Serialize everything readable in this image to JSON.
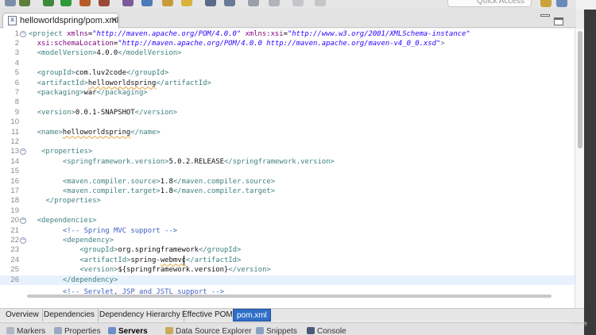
{
  "toolbar": {
    "quick_access_placeholder": "Quick Access"
  },
  "editor": {
    "tab_title": "helloworldspring/pom.xml",
    "lines": [
      {
        "n": "1",
        "html": "<span class=\"tag\">&lt;project</span> <span class=\"attr\">xmlns</span>=<span class=\"val\">\"http://maven.apache.org/POM/4.0.0\"</span> <span class=\"attr\">xmlns:xsi</span>=<span class=\"val\">\"http://www.w3.org/2001/XMLSchema-instance\"</span>",
        "indent": 0,
        "fold": true
      },
      {
        "n": "2",
        "html": "<span class=\"attr\">xsi:schemaLocation</span>=<span class=\"val\">\"http://maven.apache.org/POM/4.0.0 http://maven.apache.org/maven-v4_0_0.xsd\"</span><span class=\"tag\">&gt;</span>",
        "indent": 2
      },
      {
        "n": "3",
        "html": "<span class=\"tag\">&lt;modelVersion&gt;</span><span class=\"txt\">4.0.0</span><span class=\"tag\">&lt;/modelVersion&gt;</span>",
        "indent": 2
      },
      {
        "n": "4",
        "html": "",
        "indent": 0
      },
      {
        "n": "5",
        "html": "<span class=\"tag\">&lt;groupId&gt;</span><span class=\"txt\">com.luv2code</span><span class=\"tag\">&lt;/groupId&gt;</span>",
        "indent": 2
      },
      {
        "n": "6",
        "html": "<span class=\"tag\">&lt;artifactId&gt;</span><span class=\"txt sq\">helloworldspring</span><span class=\"tag\">&lt;/artifactId&gt;</span>",
        "indent": 2
      },
      {
        "n": "7",
        "html": "<span class=\"tag\">&lt;packaging&gt;</span><span class=\"txt\">war</span><span class=\"tag\">&lt;/packaging&gt;</span>",
        "indent": 2
      },
      {
        "n": "8",
        "html": "",
        "indent": 0
      },
      {
        "n": "9",
        "html": "<span class=\"tag\">&lt;version&gt;</span><span class=\"txt\">0.0.1-SNAPSHOT</span><span class=\"tag\">&lt;/version&gt;</span>",
        "indent": 2
      },
      {
        "n": "10",
        "html": "",
        "indent": 0
      },
      {
        "n": "11",
        "html": "<span class=\"tag\">&lt;name&gt;</span><span class=\"txt sq\">helloworldspring</span><span class=\"tag\">&lt;/name&gt;</span>",
        "indent": 2
      },
      {
        "n": "12",
        "html": "",
        "indent": 0
      },
      {
        "n": "13",
        "html": "<span class=\"tag\">&lt;properties&gt;</span>",
        "indent": 3,
        "fold": true
      },
      {
        "n": "14",
        "html": "<span class=\"tag\">&lt;springframework.version&gt;</span><span class=\"txt\">5.0.2.RELEASE</span><span class=\"tag\">&lt;/springframework.version&gt;</span>",
        "indent": 8
      },
      {
        "n": "15",
        "html": "",
        "indent": 0
      },
      {
        "n": "16",
        "html": "<span class=\"tag\">&lt;maven.compiler.source&gt;</span><span class=\"txt\">1.8</span><span class=\"tag\">&lt;/maven.compiler.source&gt;</span>",
        "indent": 8
      },
      {
        "n": "17",
        "html": "<span class=\"tag\">&lt;maven.compiler.target&gt;</span><span class=\"txt\">1.8</span><span class=\"tag\">&lt;/maven.compiler.target&gt;</span>",
        "indent": 8
      },
      {
        "n": "18",
        "html": "<span class=\"tag\">&lt;/properties&gt;</span>",
        "indent": 4
      },
      {
        "n": "19",
        "html": "",
        "indent": 0
      },
      {
        "n": "20",
        "html": "<span class=\"tag\">&lt;dependencies&gt;</span>",
        "indent": 2,
        "fold": true
      },
      {
        "n": "21",
        "html": "<span class=\"cmt\">&lt;!-- Spring MVC support --&gt;</span>",
        "indent": 8
      },
      {
        "n": "22",
        "html": "<span class=\"tag\">&lt;dependency&gt;</span>",
        "indent": 8,
        "fold": true
      },
      {
        "n": "23",
        "html": "<span class=\"tag\">&lt;groupId&gt;</span><span class=\"txt\">org.springframework</span><span class=\"tag\">&lt;/groupId&gt;</span>",
        "indent": 12
      },
      {
        "n": "24",
        "html": "<span class=\"tag\">&lt;artifactId&gt;</span><span class=\"txt\">spring-<span class=\"sq\">webmvc</span></span><span class=\"tag\">&lt;/artifactId&gt;</span>",
        "indent": 12
      },
      {
        "n": "25",
        "html": "<span class=\"tag\">&lt;version&gt;</span><span class=\"txt\">${springframework.version}</span><span class=\"tag\">&lt;/version&gt;</span>",
        "indent": 12
      },
      {
        "n": "26",
        "html": "<span class=\"tag\">&lt;/dependency&gt;</span>",
        "indent": 8,
        "current": true
      },
      {
        "n": "",
        "html": "<span class=\"cmt\">&lt;!-- Servlet, JSP and JSTL support --&gt;</span>",
        "indent": 8,
        "cut": true
      }
    ]
  },
  "page_tabs": [
    {
      "label": "Overview"
    },
    {
      "label": "Dependencies"
    },
    {
      "label": "Dependency Hierarchy"
    },
    {
      "label": "Effective POM"
    },
    {
      "label": "pom.xml",
      "active": true
    }
  ],
  "views": [
    {
      "label": "Markers",
      "color": "#b0b6c4"
    },
    {
      "label": "Properties",
      "color": "#9aa8c0"
    },
    {
      "label": "Servers",
      "color": "#6e8fc4",
      "active": true
    },
    {
      "label": "Data Source Explorer",
      "color": "#c9a95a"
    },
    {
      "label": "Snippets",
      "color": "#8aa2c2"
    },
    {
      "label": "Console",
      "color": "#4a5a7a"
    }
  ]
}
